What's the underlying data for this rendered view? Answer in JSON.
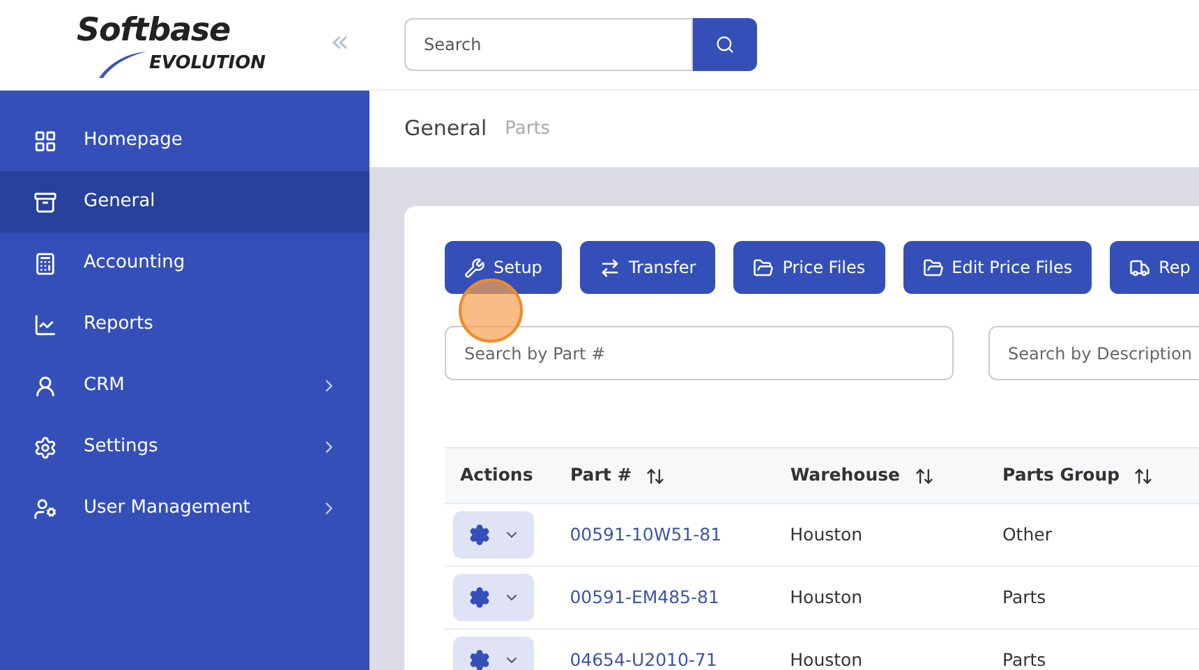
{
  "logo": {
    "line_1": "Softbase",
    "line_2": "EVOLUTION"
  },
  "sidebar": {
    "collapse_icon": "«",
    "items": [
      {
        "label": "Homepage",
        "selected": false,
        "has_submenu": false
      },
      {
        "label": "General",
        "selected": true,
        "has_submenu": false
      },
      {
        "label": "Accounting",
        "selected": false,
        "has_submenu": false
      },
      {
        "label": "Reports",
        "selected": false,
        "has_submenu": false
      },
      {
        "label": "CRM",
        "selected": false,
        "has_submenu": true
      },
      {
        "label": "Settings",
        "selected": false,
        "has_submenu": true
      },
      {
        "label": "User Management",
        "selected": false,
        "has_submenu": true
      }
    ]
  },
  "header": {
    "search": {
      "placeholder": "Search"
    }
  },
  "breadcrumb": [
    {
      "label": "General",
      "selected": true
    },
    {
      "label": "Parts",
      "selected": false
    }
  ],
  "toolbar": [
    {
      "label": "Setup"
    },
    {
      "label": "Transfer"
    },
    {
      "label": "Price Files"
    },
    {
      "label": "Edit Price Files"
    },
    {
      "label": "Rep"
    }
  ],
  "filters": [
    {
      "placeholder": "Search by Part #"
    },
    {
      "placeholder": "Search by Description"
    }
  ],
  "table": {
    "columns": [
      "Actions",
      "Part #",
      "Warehouse",
      "Parts Group"
    ],
    "rows": [
      {
        "part": "00591-10W51-81",
        "warehouse": "Houston",
        "group": "Other"
      },
      {
        "part": "00591-EM485-81",
        "warehouse": "Houston",
        "group": "Parts"
      },
      {
        "part": "04654-U2010-71",
        "warehouse": "Houston",
        "group": "Parts"
      }
    ]
  }
}
